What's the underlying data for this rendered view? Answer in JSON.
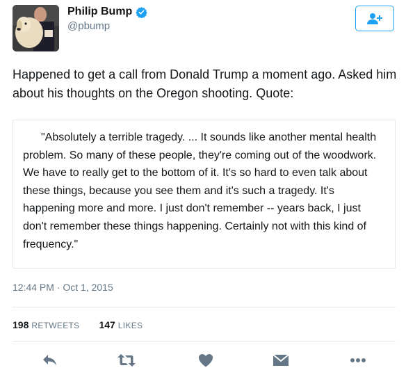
{
  "user": {
    "display_name": "Philip Bump",
    "handle": "@pbump"
  },
  "tweet": {
    "text": "Happened to get a call from Donald Trump a moment ago. Asked him about his thoughts on the Oregon shooting. Quote:",
    "quote": "\"Absolutely a terrible tragedy. ... It sounds like another mental health problem. So many of these people, they're coming out of the woodwork. We have to really get to the bottom of it. It's so hard to even talk about these things, because you see them and it's such a tragedy. It's happening more and more. I just don't remember -- years back, I just don't remember these things happening. Certainly not with this kind of frequency.\"",
    "timestamp": "12:44 PM · Oct 1, 2015"
  },
  "stats": {
    "retweets_count": "198",
    "retweets_label": "RETWEETS",
    "likes_count": "147",
    "likes_label": "LIKES"
  },
  "colors": {
    "accent": "#1da1f2",
    "muted": "#657786",
    "icon": "#657786",
    "border": "#e1e8ed"
  },
  "icons": [
    "verified-badge-icon",
    "follow-person-plus-icon",
    "reply-icon",
    "retweet-icon",
    "like-heart-icon",
    "direct-message-icon",
    "more-icon"
  ]
}
